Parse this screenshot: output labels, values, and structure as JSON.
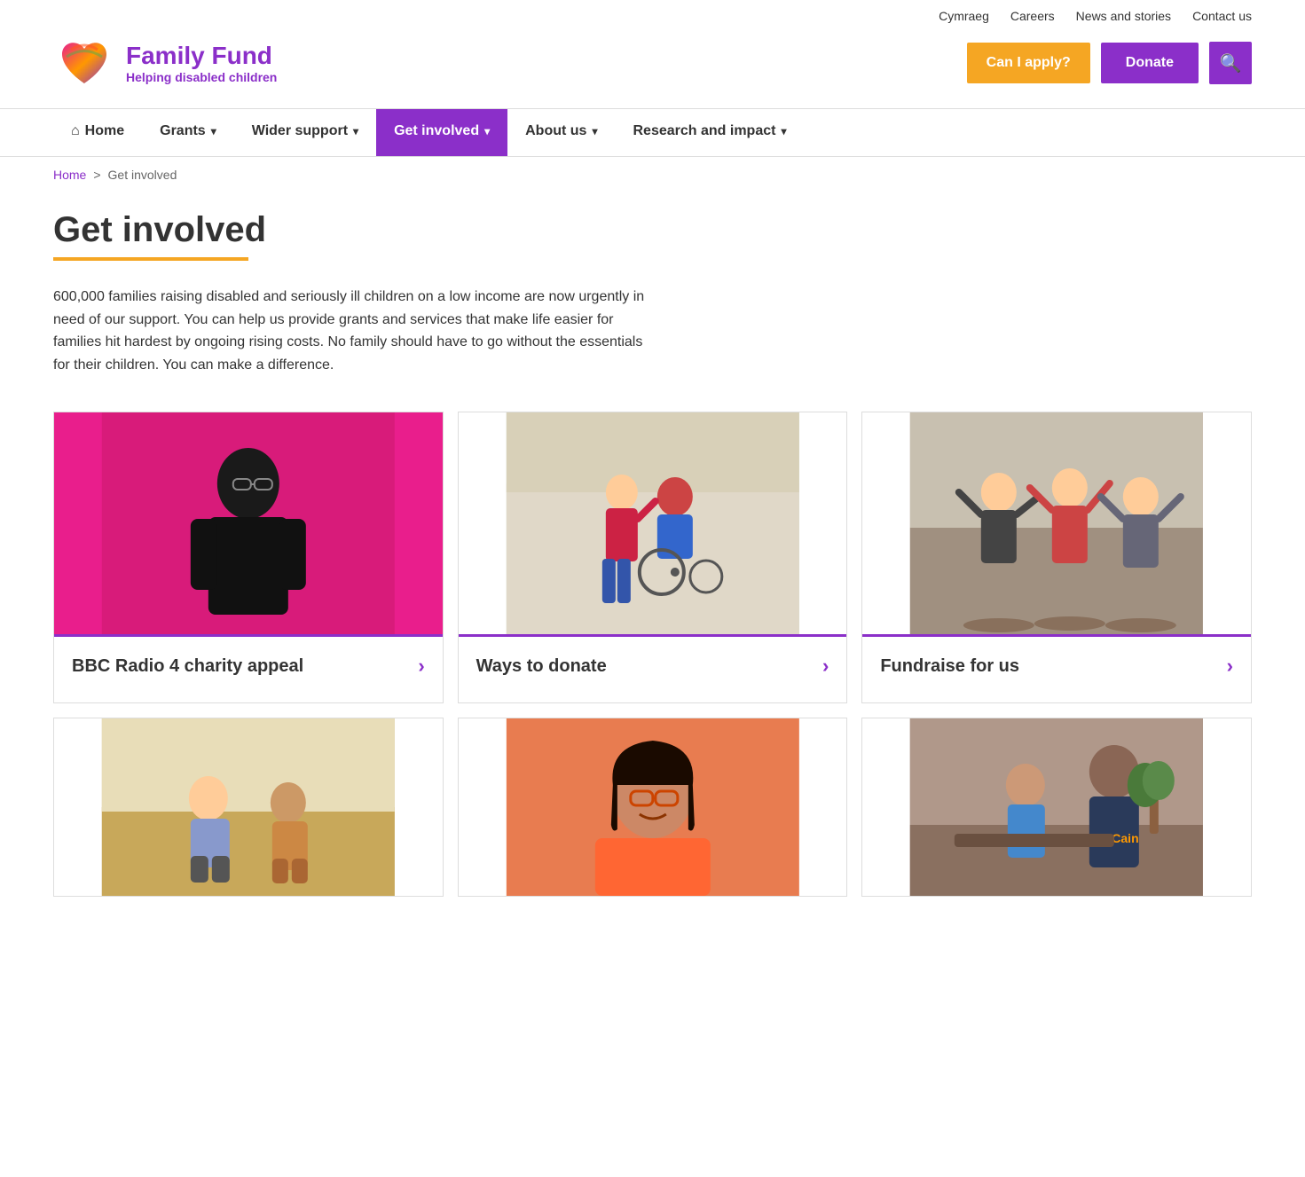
{
  "site": {
    "title": "Family Fund",
    "subtitle": "Helping disabled children"
  },
  "topbar": {
    "links": [
      {
        "label": "Cymraeg",
        "href": "#"
      },
      {
        "label": "Careers",
        "href": "#"
      },
      {
        "label": "News and stories",
        "href": "#"
      },
      {
        "label": "Contact us",
        "href": "#"
      }
    ]
  },
  "header": {
    "can_apply_label": "Can I apply?",
    "donate_label": "Donate",
    "search_icon": "🔍"
  },
  "nav": {
    "items": [
      {
        "label": "Home",
        "icon": "⌂",
        "active": false,
        "has_dropdown": false
      },
      {
        "label": "Grants",
        "active": false,
        "has_dropdown": true
      },
      {
        "label": "Wider support",
        "active": false,
        "has_dropdown": true
      },
      {
        "label": "Get involved",
        "active": true,
        "has_dropdown": true
      },
      {
        "label": "About us",
        "active": false,
        "has_dropdown": true
      },
      {
        "label": "Research and impact",
        "active": false,
        "has_dropdown": true
      }
    ]
  },
  "breadcrumb": {
    "home_label": "Home",
    "separator": ">",
    "current": "Get involved"
  },
  "page": {
    "title": "Get involved",
    "description": "600,000 families raising disabled and seriously ill children on a low income are now urgently in need of our support. You can help us provide grants and services that make life easier for families hit hardest by ongoing rising costs. No family should have to go without the essentials for their children. You can make a difference."
  },
  "cards": [
    {
      "title": "BBC Radio 4 charity appeal",
      "image_alt": "Man in black shirt against pink background",
      "image_color": "#e91e8c",
      "arrow": "›"
    },
    {
      "title": "Ways to donate",
      "image_alt": "Boy in wheelchair with friend outdoors",
      "image_color": "#8db87a",
      "arrow": "›"
    },
    {
      "title": "Fundraise for us",
      "image_alt": "Women celebrating muddy run",
      "image_color": "#a0856c",
      "arrow": "›"
    }
  ],
  "cards_row2": [
    {
      "image_alt": "Two kids sitting outdoors",
      "image_color": "#c8a86b"
    },
    {
      "image_alt": "Smiling woman with glasses",
      "image_color": "#e87c50"
    },
    {
      "image_alt": "McCain family scene",
      "image_color": "#6b4f3a"
    }
  ]
}
